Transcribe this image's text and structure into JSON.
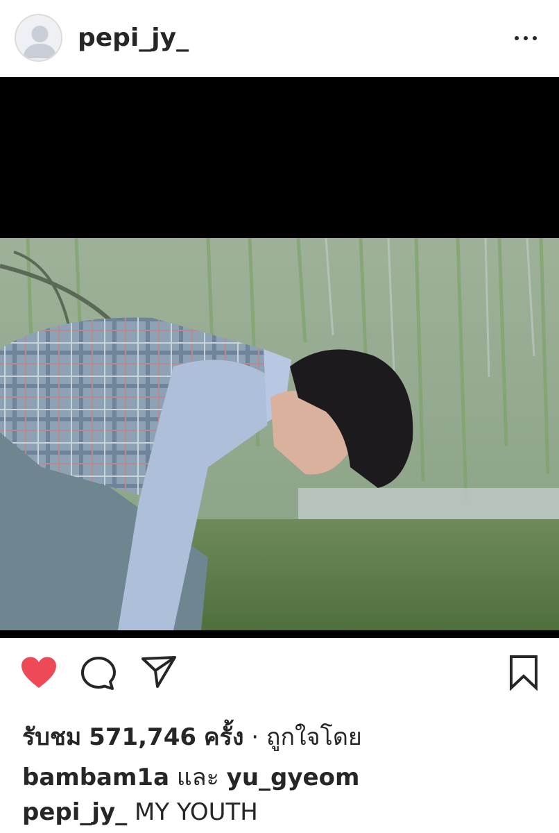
{
  "post": {
    "username": "pepi_jy_"
  },
  "actions": {
    "liked": true,
    "like_color": "#ed4956",
    "icons": [
      "heart-icon",
      "comment-icon",
      "send-icon",
      "bookmark-icon"
    ]
  },
  "stats": {
    "views_prefix": "รับชม",
    "views_count": "571,746",
    "views_suffix": "ครั้ง",
    "separator": "·",
    "liked_by_prefix": "ถูกใจโดย",
    "liker_1": "bambam1a",
    "conjunction": "และ",
    "liker_2": "yu_gyeom"
  },
  "caption": {
    "username": "pepi_jy_",
    "text": "MY YOUTH"
  }
}
